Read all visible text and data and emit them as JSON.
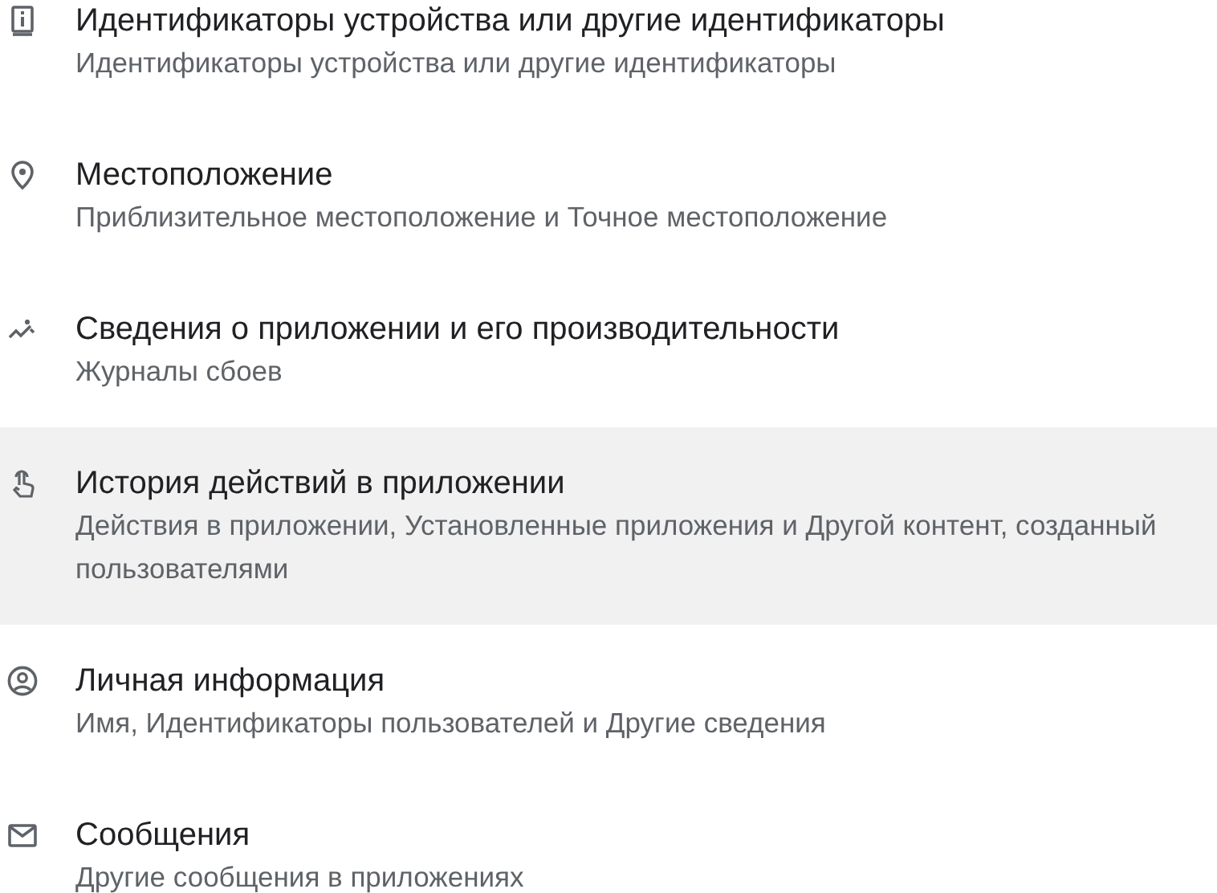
{
  "items": [
    {
      "kind": "device",
      "title": "Идентификаторы устройства или другие идентификаторы",
      "subtitle": "Идентификаторы устройства или другие идентификаторы",
      "selected": false
    },
    {
      "kind": "location",
      "title": "Местоположение",
      "subtitle": "Приблизительное местоположение и Точное местоположение",
      "selected": false
    },
    {
      "kind": "trend",
      "title": "Сведения о приложении и его производительности",
      "subtitle": "Журналы сбоев",
      "selected": false
    },
    {
      "kind": "touch",
      "title": "История действий в приложении",
      "subtitle": "Действия в приложении, Установленные приложения и Другой контент, созданный пользователями",
      "selected": true
    },
    {
      "kind": "person",
      "title": "Личная информация",
      "subtitle": "Имя, Идентификаторы пользователей и Другие сведения",
      "selected": false
    },
    {
      "kind": "mail",
      "title": "Сообщения",
      "subtitle": "Другие сообщения в приложениях",
      "selected": false
    }
  ]
}
